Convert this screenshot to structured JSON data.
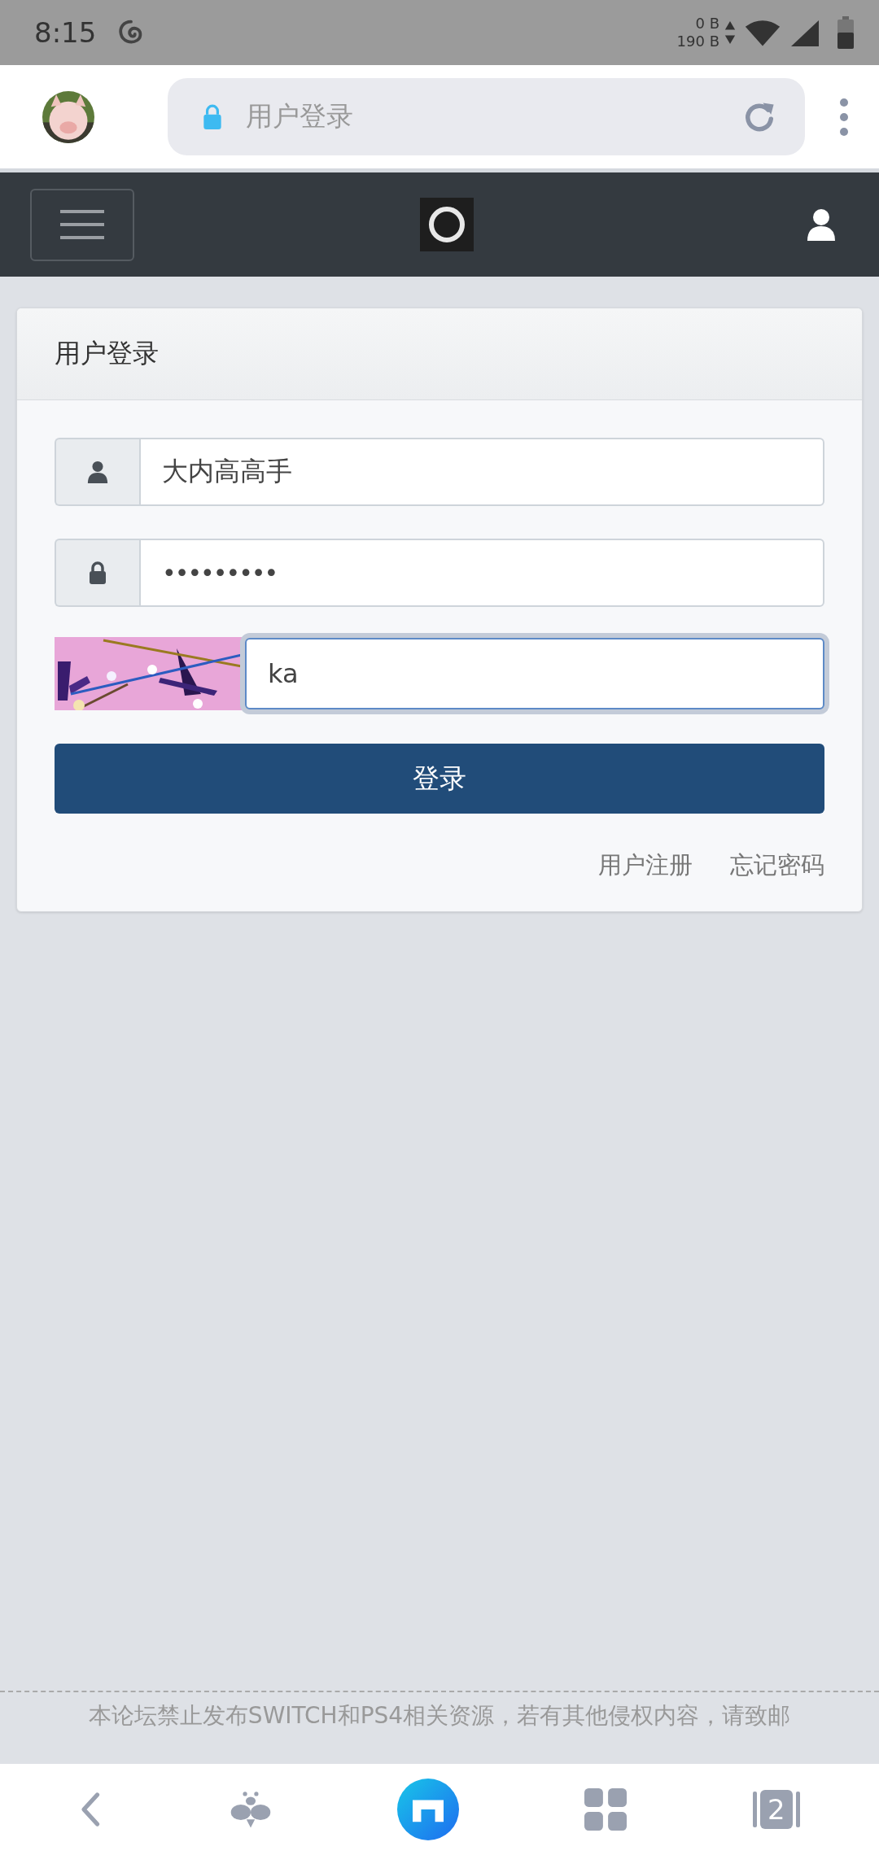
{
  "status_bar": {
    "time": "8:15",
    "net_up": "0 B",
    "net_down": "190 B"
  },
  "browser": {
    "address": "用户登录",
    "tab_count": "2"
  },
  "login": {
    "title": "用户登录",
    "username": {
      "value": "大内高高手"
    },
    "password": {
      "value": "•••••••••"
    },
    "captcha": {
      "value": "ka",
      "focused": true
    },
    "submit": "登录",
    "links": [
      "用户注册",
      "忘记密码"
    ]
  },
  "footer": {
    "notice": "本论坛禁止发布SWITCH和PS4相关资源，若有其他侵权内容，请致邮"
  }
}
